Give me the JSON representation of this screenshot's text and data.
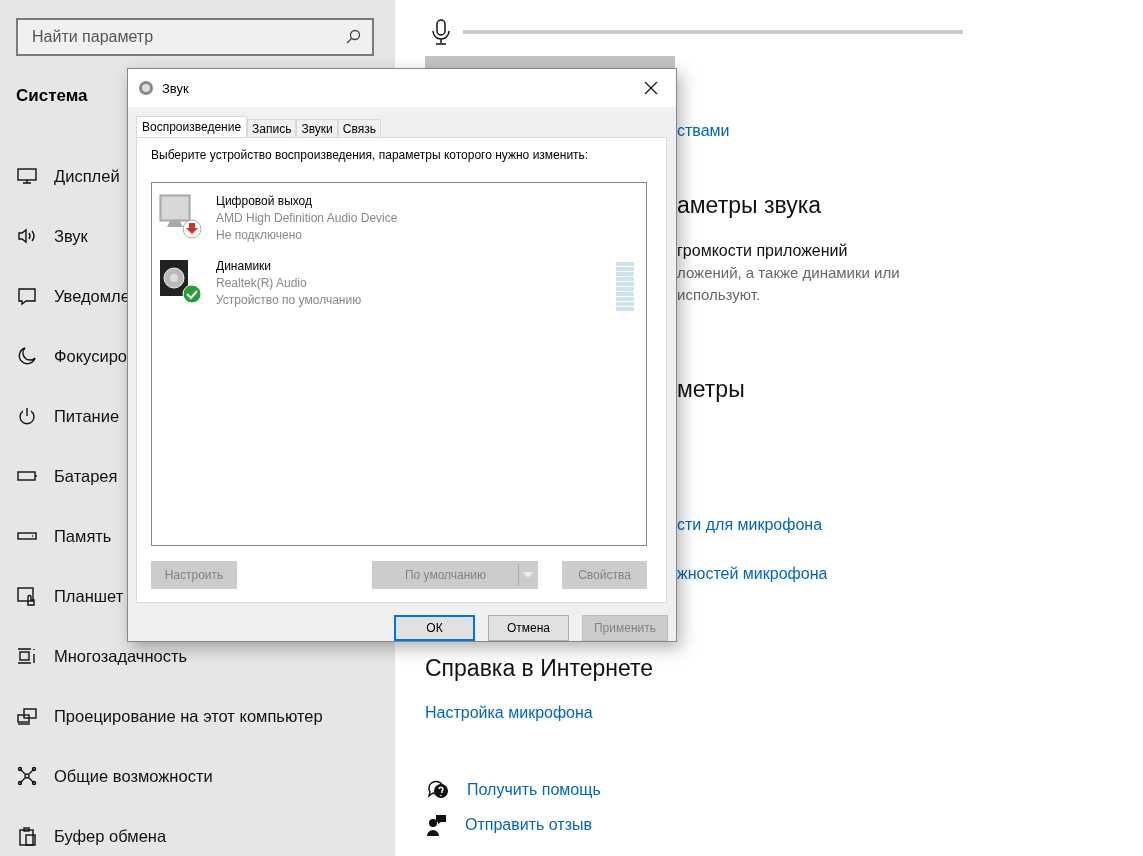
{
  "settings": {
    "search": {
      "placeholder": "Найти параметр"
    },
    "section_title": "Система",
    "nav_items": [
      {
        "label": "Дисплей"
      },
      {
        "label": "Звук"
      },
      {
        "label": "Уведомле"
      },
      {
        "label": "Фокусиро"
      },
      {
        "label": "Питание"
      },
      {
        "label": "Батарея"
      },
      {
        "label": "Память"
      },
      {
        "label": "Планшет"
      },
      {
        "label": "Многозадачность"
      },
      {
        "label": "Проецирование на этот компьютер"
      },
      {
        "label": "Общие возможности"
      },
      {
        "label": "Буфер обмена"
      }
    ],
    "covered_content": [
      {
        "kind": "link",
        "text": "ствами"
      },
      {
        "kind": "heading",
        "text": "аметры звука"
      },
      {
        "kind": "title",
        "text": "громкости приложений"
      },
      {
        "kind": "text",
        "text": "ложений, а также динамики или"
      },
      {
        "kind": "text",
        "text": "используют."
      },
      {
        "kind": "heading",
        "text": "метры"
      },
      {
        "kind": "link",
        "text": "сти для микрофона"
      },
      {
        "kind": "link",
        "text": "жностей микрофона"
      }
    ],
    "help": {
      "title": "Справка в Интернете",
      "links": [
        {
          "text": "Настройка микрофона"
        }
      ]
    },
    "actions": [
      {
        "text": "Получить помощь"
      },
      {
        "text": "Отправить отзыв"
      }
    ]
  },
  "dialog": {
    "title": "Звук",
    "tabs": [
      {
        "label": "Воспроизведение",
        "selected": true
      },
      {
        "label": "Запись",
        "selected": false
      },
      {
        "label": "Звуки",
        "selected": false
      },
      {
        "label": "Связь",
        "selected": false
      }
    ],
    "instruction": "Выберите устройство воспроизведения, параметры которого нужно изменить:",
    "devices": [
      {
        "kind": "disconnected",
        "name": "Цифровой выход",
        "driver": "AMD High Definition Audio Device",
        "status": "Не подключено"
      },
      {
        "kind": "default",
        "name": "Динамики",
        "driver": "Realtek(R) Audio",
        "status": "Устройство по умолчанию"
      }
    ],
    "panel_buttons": [
      {
        "label": "Настроить",
        "disabled": true,
        "kind": "plain"
      },
      {
        "label": "По умолчанию",
        "disabled": true,
        "kind": "split"
      },
      {
        "label": "Свойства",
        "disabled": true,
        "kind": "plain"
      }
    ],
    "buttons": [
      {
        "label": "ОК",
        "disabled": false,
        "default": true
      },
      {
        "label": "Отмена",
        "disabled": false,
        "default": false
      },
      {
        "label": "Применить",
        "disabled": true,
        "default": false
      }
    ]
  }
}
